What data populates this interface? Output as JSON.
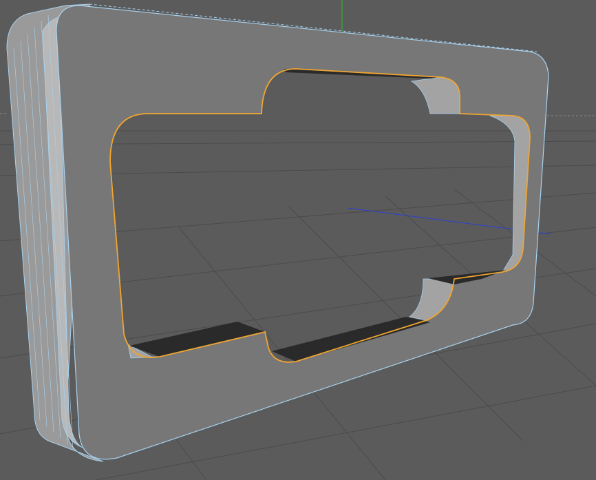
{
  "viewport": {
    "colors": {
      "background": "#5b5b5b",
      "grid_line": "#4a4a4a",
      "object_face": "#7a7a7a",
      "object_bevel": "#9a9a9a",
      "wire": "#a9d2ef",
      "selection_outline": "#f0a530",
      "axis_y": "#2fbf2f",
      "axis_z": "#2b3fd6",
      "hole_floor": "#2a2a2a"
    },
    "axes": {
      "y": "y-axis",
      "z": "z-axis"
    },
    "object": {
      "name": "beveled-rectangular-frame",
      "state": "selected"
    }
  }
}
